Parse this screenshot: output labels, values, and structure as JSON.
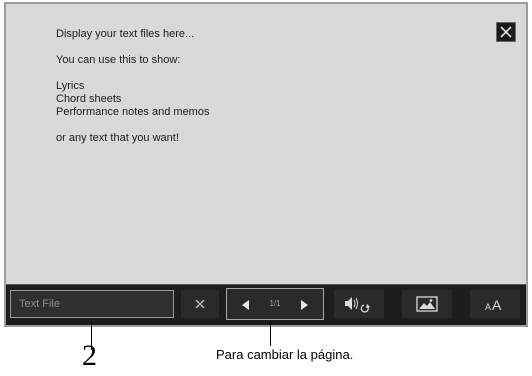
{
  "text_display": {
    "lines": [
      "Display your text files here...",
      "You can use this to show:",
      "Lyrics",
      "Chord sheets",
      "Performance notes and memos",
      "or any text that you want!"
    ]
  },
  "toolbar": {
    "text_file_placeholder": "Text File",
    "page_indicator": "1/1",
    "font_size_label": "AA"
  },
  "annotations": {
    "callout_number": "2",
    "pager_caption": "Para cambiar la página."
  },
  "icons": {
    "close": "close-icon",
    "clear": "clear-icon",
    "prev": "triangle-left-icon",
    "next": "triangle-right-icon",
    "audio": "speaker-repeat-icon",
    "image": "image-icon",
    "font_size": "font-size-icon"
  },
  "colors": {
    "screen_background": "#d9d9d9",
    "toolbar_background": "#1d1d1d",
    "text": "#1c1c1c"
  }
}
